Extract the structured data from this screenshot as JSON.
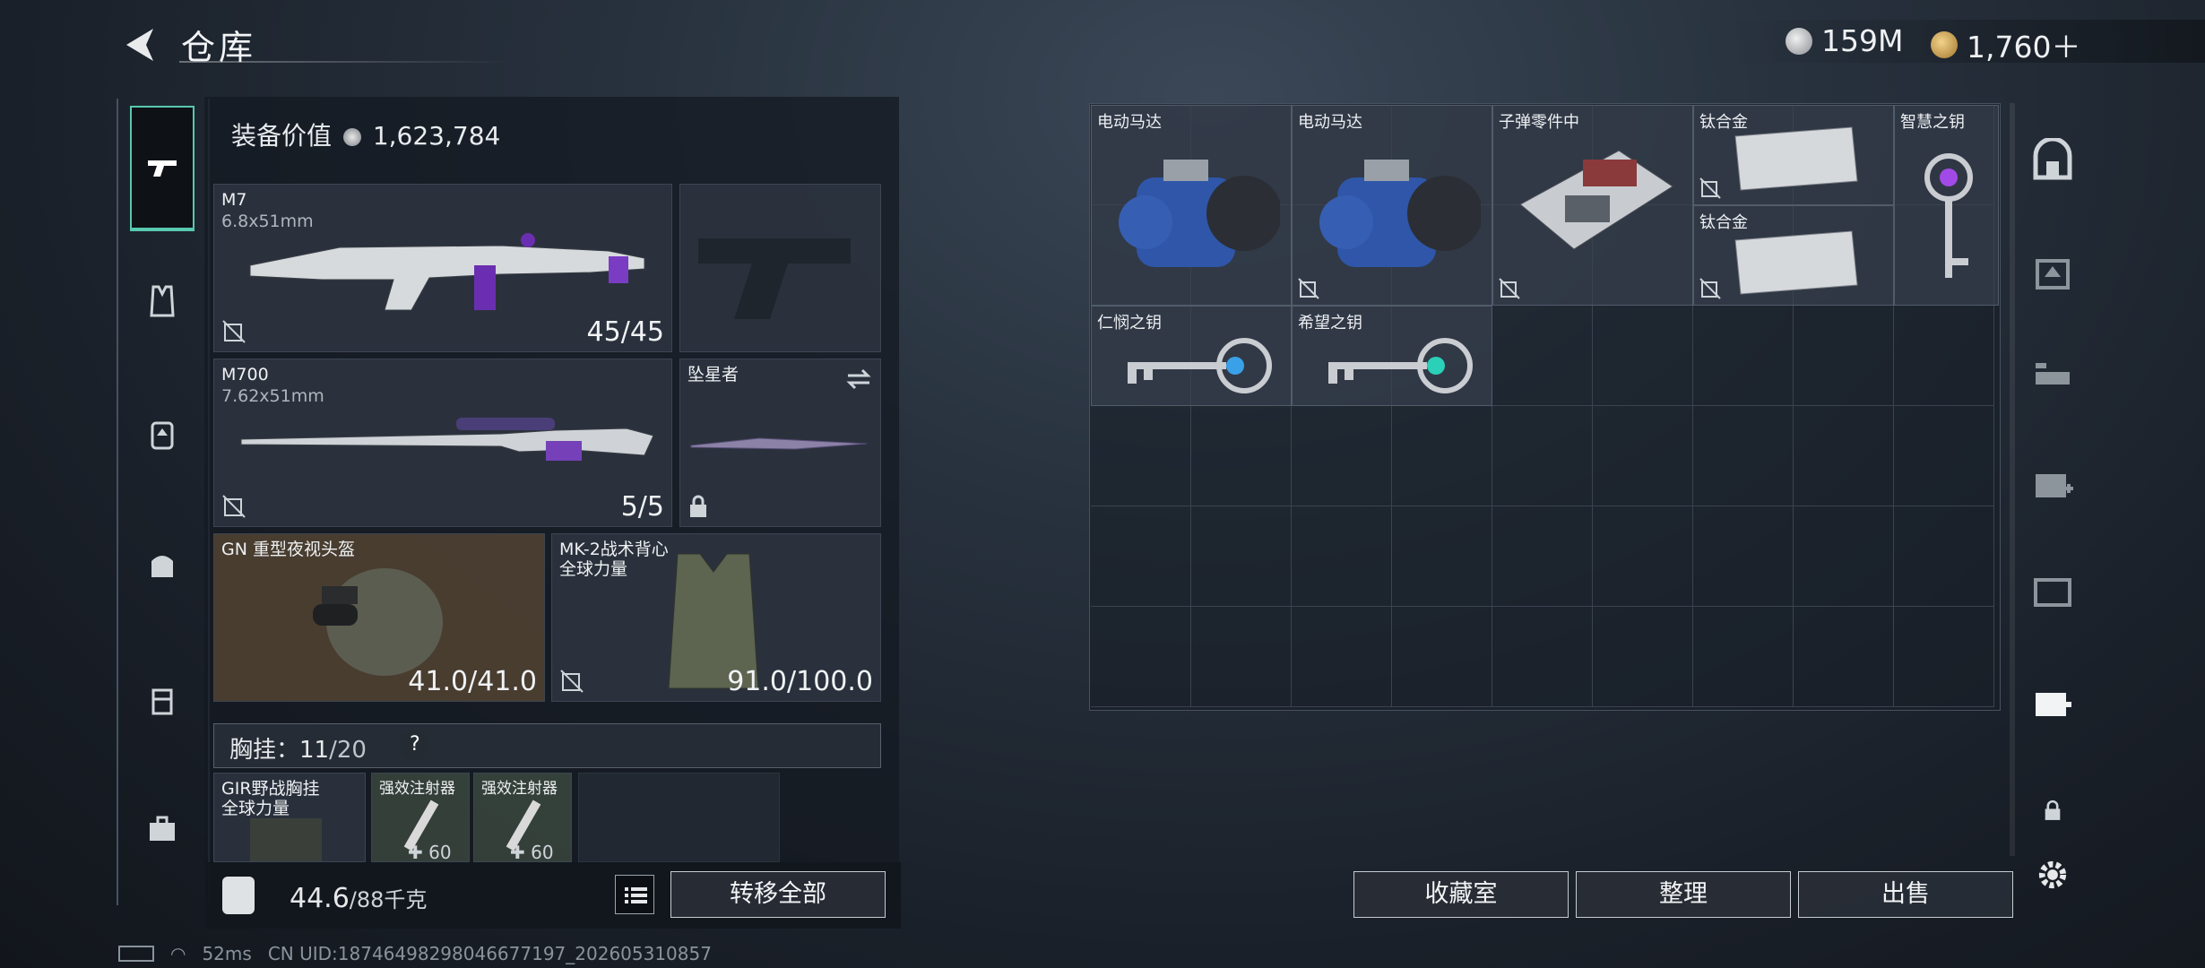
{
  "header": {
    "title": "仓库"
  },
  "currency": [
    {
      "icon": "silver-coin-icon",
      "value": "159M"
    },
    {
      "icon": "gold-coin-icon",
      "value": "1,760＋"
    }
  ],
  "loadout": {
    "equip_value_label": "装备价值",
    "equip_value": "1,623,784",
    "primary": {
      "name": "M7",
      "ammo_type": "6.8x51mm",
      "count": "45/45"
    },
    "secondary": {
      "name": "M700",
      "ammo_type": "7.62x51mm",
      "count": "5/5"
    },
    "melee": {
      "name": "坠星者"
    },
    "helmet": {
      "name": "GN 重型夜视头盔",
      "durability": "41.0/41.0"
    },
    "armor": {
      "name": "MK-2战术背心",
      "subname": "全球力量",
      "durability": "91.0/100.0"
    },
    "chest_rig_label": "胸挂：",
    "chest_rig_used": "11",
    "chest_rig_total": "/20",
    "chest_help": "?",
    "rig": {
      "name": "GIR野战胸挂",
      "subname": "全球力量"
    },
    "rig_items": [
      {
        "name": "强效注射器",
        "count": "✚ 60"
      },
      {
        "name": "强效注射器",
        "count": "✚ 60"
      }
    ],
    "weight": "44.6",
    "weight_max": "/88千克",
    "transfer_all": "转移全部"
  },
  "storage": {
    "items": [
      {
        "name": "电动马达",
        "icon": "electric-motor-icon"
      },
      {
        "name": "电动马达",
        "icon": "electric-motor-icon"
      },
      {
        "name": "子弹零件中",
        "icon": "ammo-parts-box-icon"
      },
      {
        "name": "钛合金",
        "icon": "titanium-ingot-icon"
      },
      {
        "name": "钛合金",
        "icon": "titanium-ingot-icon"
      },
      {
        "name": "智慧之钥",
        "icon": "key-purple-icon"
      },
      {
        "name": "仁悯之钥",
        "icon": "key-blue-icon"
      },
      {
        "name": "希望之钥",
        "icon": "key-teal-icon"
      }
    ],
    "buttons": {
      "collect": "收藏室",
      "sort": "整理",
      "sell": "出售"
    }
  },
  "status": {
    "ping": "52ms",
    "uid": "CN UID:18746498298046677197_202605310857"
  }
}
